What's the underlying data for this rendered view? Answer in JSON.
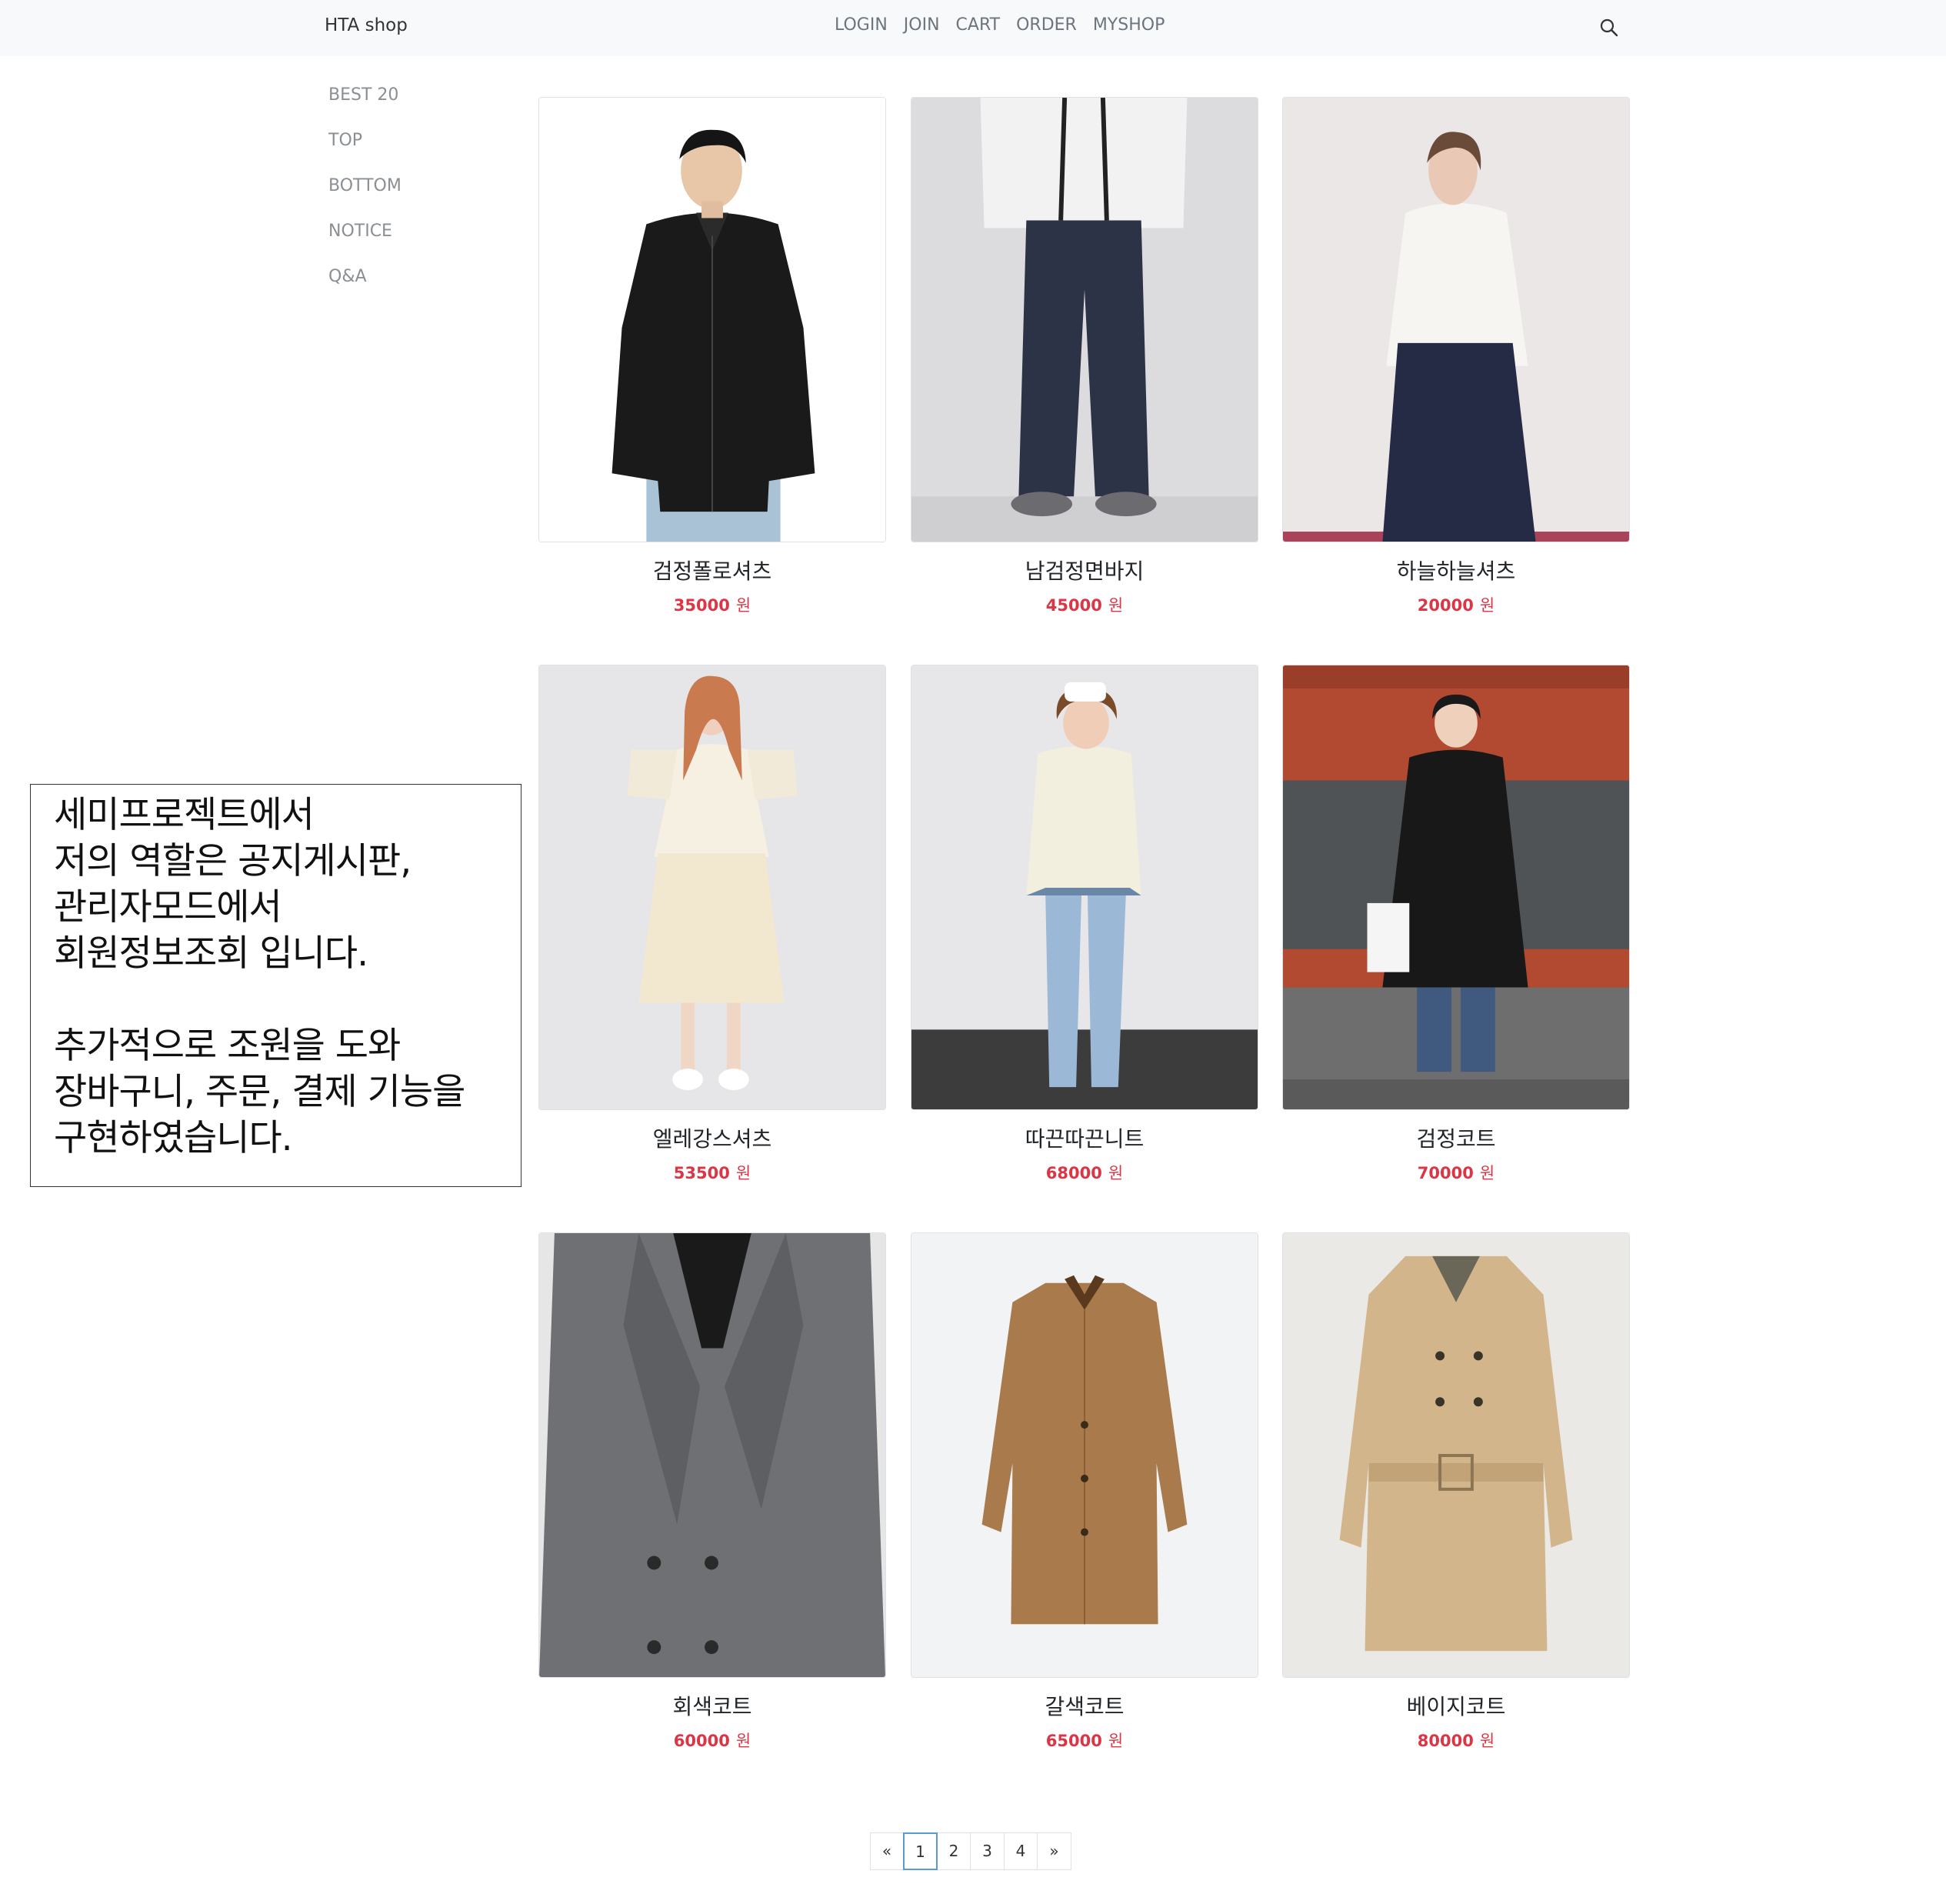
{
  "navbar": {
    "brand": "HTA shop",
    "links": [
      "LOGIN",
      "JOIN",
      "CART",
      "ORDER",
      "MYSHOP"
    ],
    "search_icon": "search-icon"
  },
  "sidebar": {
    "items": [
      "BEST 20",
      "TOP",
      "BOTTOM",
      "NOTICE",
      "Q&A"
    ]
  },
  "note": {
    "paragraph1": "세미프로젝트에서\n저의 역할은 공지게시판,\n관리자모드에서\n회원정보조회 입니다.",
    "paragraph2": "추가적으로 조원을 도와\n장바구니, 주문, 결제 기능을\n구현하였습니다."
  },
  "products": [
    {
      "name": "검정폴로셔츠",
      "price": "35000",
      "currency": "원"
    },
    {
      "name": "남검정면바지",
      "price": "45000",
      "currency": "원"
    },
    {
      "name": "하늘하늘셔츠",
      "price": "20000",
      "currency": "원"
    },
    {
      "name": "엘레강스셔츠",
      "price": "53500",
      "currency": "원"
    },
    {
      "name": "따끈따끈니트",
      "price": "68000",
      "currency": "원"
    },
    {
      "name": "검정코트",
      "price": "70000",
      "currency": "원"
    },
    {
      "name": "회색코트",
      "price": "60000",
      "currency": "원"
    },
    {
      "name": "갈색코트",
      "price": "65000",
      "currency": "원"
    },
    {
      "name": "베이지코트",
      "price": "80000",
      "currency": "원"
    }
  ],
  "pagination": {
    "prev": "«",
    "pages": [
      "1",
      "2",
      "3",
      "4"
    ],
    "next": "»",
    "current": "1"
  },
  "colors": {
    "navbar_bg": "#f8f9fa",
    "price": "#dc3545",
    "active_page_border": "#5b9bd5"
  }
}
